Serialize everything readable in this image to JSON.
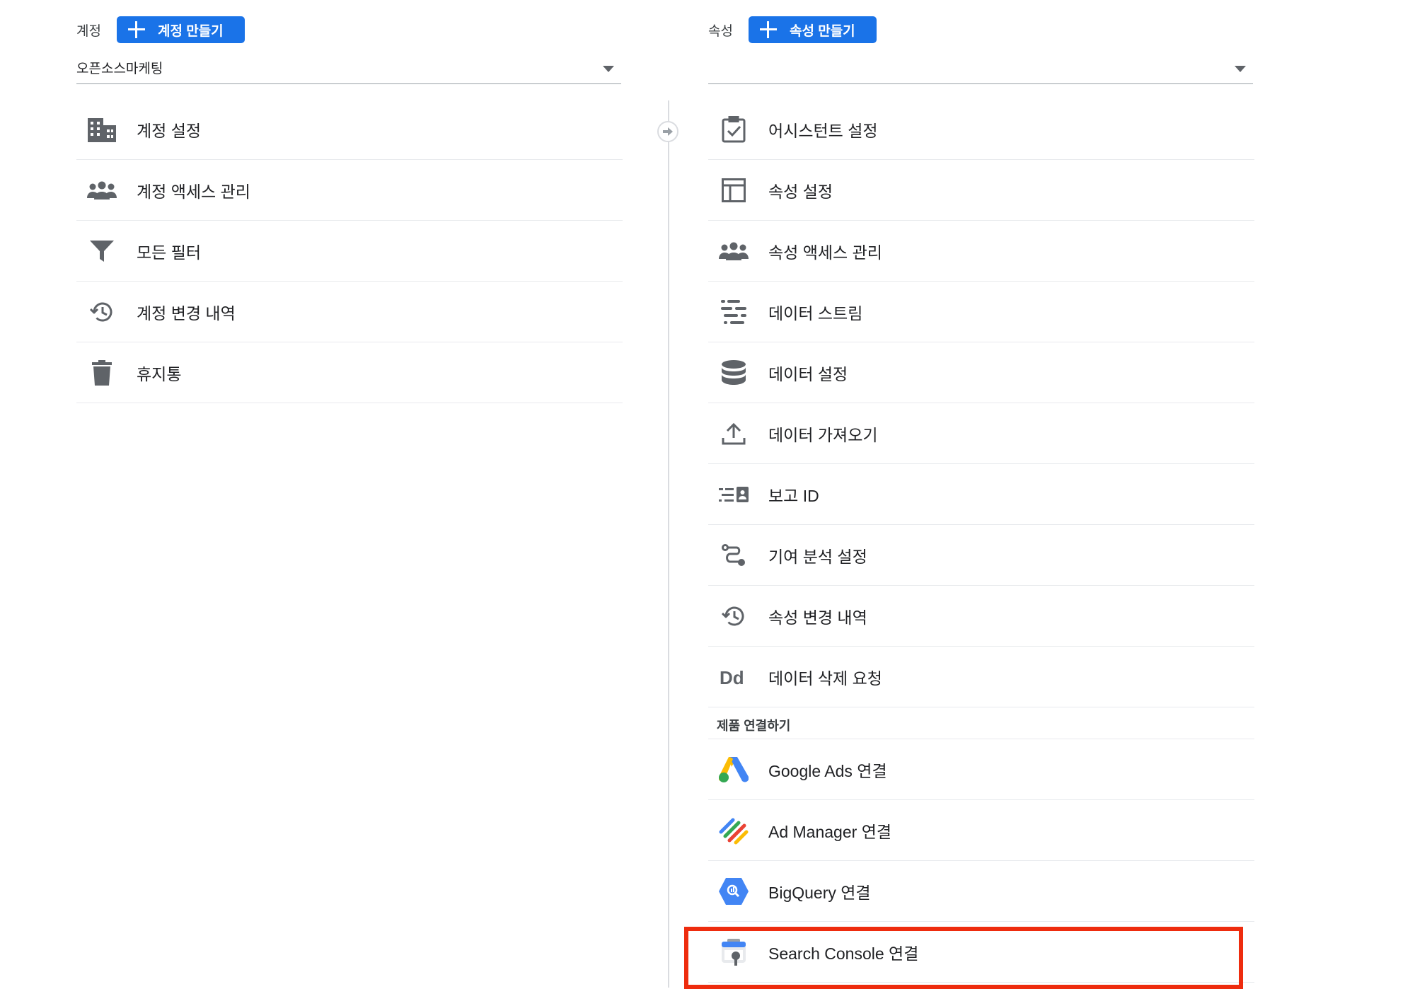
{
  "account": {
    "label": "계정",
    "create_button": "계정 만들기",
    "selected": "오픈소스마케팅",
    "items": [
      {
        "label": "계정 설정",
        "icon": "building-icon"
      },
      {
        "label": "계정 액세스 관리",
        "icon": "people-icon"
      },
      {
        "label": "모든 필터",
        "icon": "filter-icon"
      },
      {
        "label": "계정 변경 내역",
        "icon": "history-icon"
      },
      {
        "label": "휴지통",
        "icon": "trash-icon"
      }
    ]
  },
  "property": {
    "label": "속성",
    "create_button": "속성 만들기",
    "selected": "",
    "items": [
      {
        "label": "어시스턴트 설정",
        "icon": "clipboard-check-icon"
      },
      {
        "label": "속성 설정",
        "icon": "layout-icon"
      },
      {
        "label": "속성 액세스 관리",
        "icon": "people-icon"
      },
      {
        "label": "데이터 스트림",
        "icon": "data-stream-icon"
      },
      {
        "label": "데이터 설정",
        "icon": "database-icon"
      },
      {
        "label": "데이터 가져오기",
        "icon": "upload-icon"
      },
      {
        "label": "보고 ID",
        "icon": "reporting-id-icon"
      },
      {
        "label": "기여 분석 설정",
        "icon": "attribution-icon"
      },
      {
        "label": "속성 변경 내역",
        "icon": "history-icon"
      },
      {
        "label": "데이터 삭제 요청",
        "icon": "dd-icon"
      }
    ],
    "product_links_title": "제품 연결하기",
    "product_links": [
      {
        "label": "Google Ads 연결",
        "icon": "google-ads-icon"
      },
      {
        "label": "Ad Manager 연결",
        "icon": "ad-manager-icon"
      },
      {
        "label": "BigQuery 연결",
        "icon": "bigquery-icon"
      },
      {
        "label": "Search Console 연결",
        "icon": "search-console-icon"
      }
    ]
  },
  "colors": {
    "accent": "#1a73e8",
    "highlight": "#ee2c0e",
    "icon_gray": "#5f6368"
  }
}
